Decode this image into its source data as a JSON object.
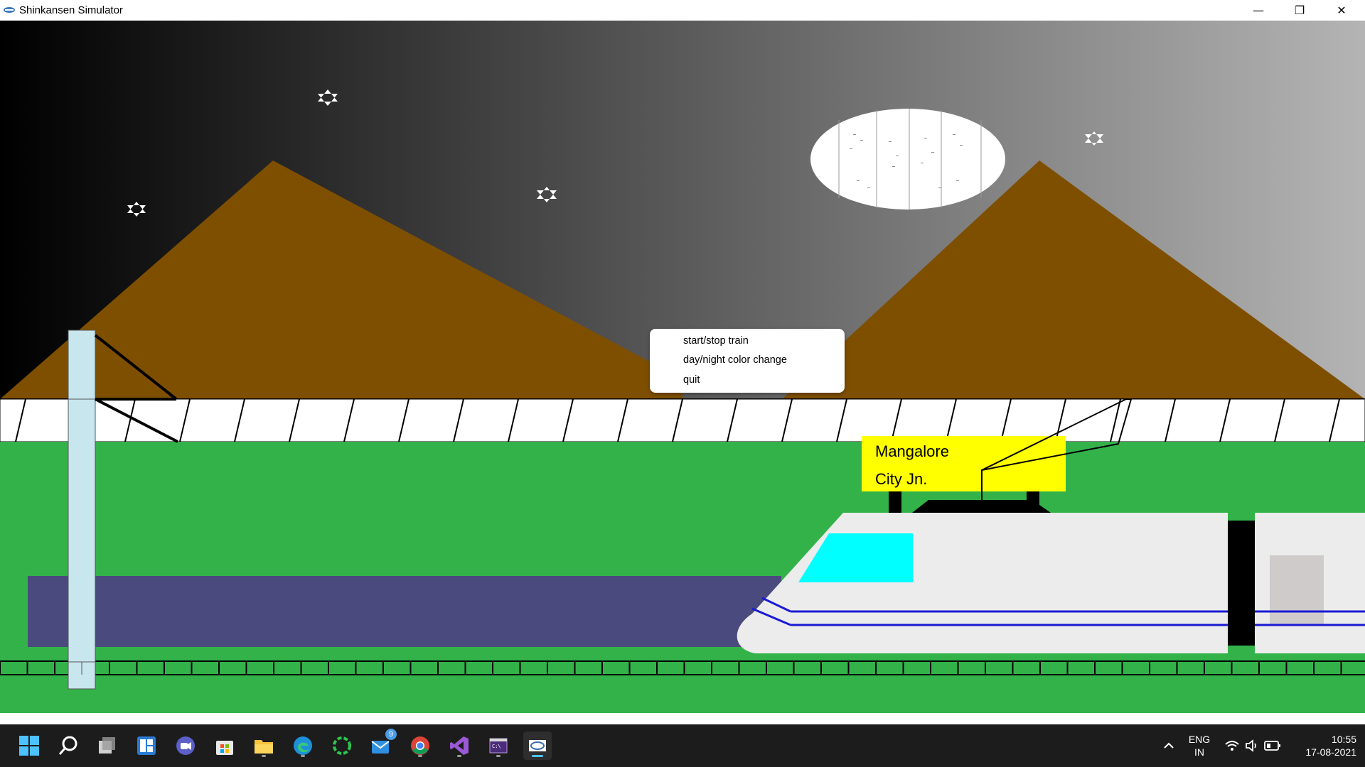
{
  "window": {
    "title": "Shinkansen Simulator",
    "controls": {
      "minimize": "—",
      "restore": "❐",
      "close": "✕"
    }
  },
  "scene": {
    "station_sign": {
      "line1": "Mangalore",
      "line2": "City Jn."
    },
    "colors": {
      "sky_left": "#000000",
      "sky_right": "#b4b4b4",
      "mountain": "#7f4f00",
      "grass": "#33b24a",
      "platform": "#4b4a7e",
      "train_body": "#ececec",
      "train_window": "#00ffff",
      "train_stripe": "#1a1ad4",
      "sign_bg": "#ffff00",
      "pole": "#c8e6ee"
    }
  },
  "context_menu": {
    "items": [
      {
        "label": "start/stop train"
      },
      {
        "label": "day/night color change"
      },
      {
        "label": "quit"
      }
    ]
  },
  "taskbar": {
    "icons": [
      "windows-start-icon",
      "search-icon",
      "task-view-icon",
      "widgets-icon",
      "teams-chat-icon",
      "microsoft-store-icon",
      "file-explorer-icon",
      "edge-icon",
      "loading-app-icon",
      "mail-icon",
      "chrome-icon",
      "visual-studio-icon",
      "terminal-icon",
      "opengl-app-icon"
    ],
    "mail_badge": "9",
    "tray": {
      "language_line1": "ENG",
      "language_line2": "IN",
      "time": "10:55",
      "date": "17-08-2021"
    }
  }
}
